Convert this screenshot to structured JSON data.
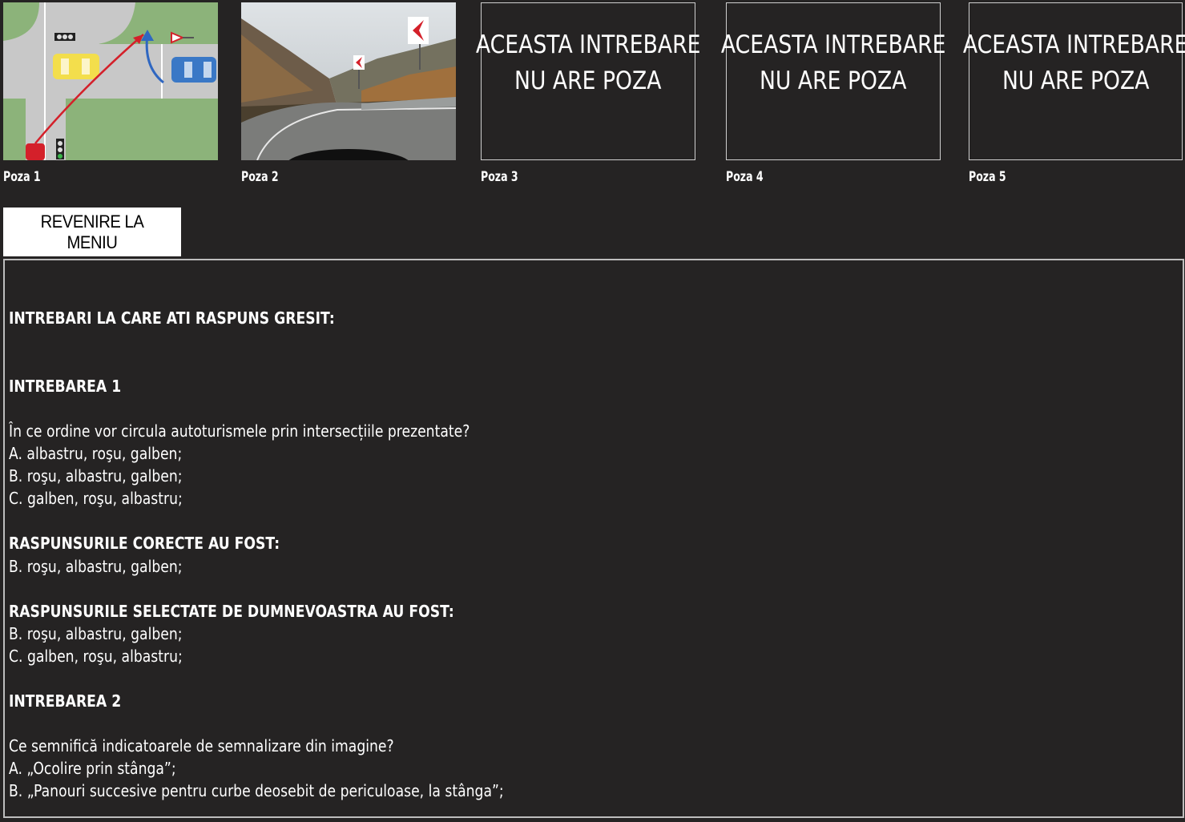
{
  "thumbnails": [
    {
      "caption": "Poza 1",
      "has_image": true
    },
    {
      "caption": "Poza 2",
      "has_image": true
    },
    {
      "caption": "Poza 3",
      "has_image": false
    },
    {
      "caption": "Poza 4",
      "has_image": false
    },
    {
      "caption": "Poza 5",
      "has_image": false
    }
  ],
  "no_image": {
    "line1": "ACEASTA INTREBARE",
    "line2": "NU ARE POZA"
  },
  "menu_button": "REVENIRE LA MENIU",
  "content": {
    "header": "INTREBARI LA CARE ATI RASPUNS GRESIT:",
    "questions": [
      {
        "title": "INTREBAREA 1",
        "text": "În ce ordine vor circula autoturismele prin intersecțiile prezentate?",
        "options": [
          "A. albastru, roşu, galben;",
          "B. roşu, albastru, galben;",
          "C. galben, roşu, albastru;"
        ],
        "correct_label": "RASPUNSURILE CORECTE AU FOST:",
        "correct": [
          "B. roşu, albastru, galben;"
        ],
        "selected_label": "RASPUNSURILE SELECTATE DE DUMNEVOASTRA AU FOST:",
        "selected": [
          "B. roşu, albastru, galben;",
          "C. galben, roşu, albastru;"
        ]
      },
      {
        "title": "INTREBAREA 2",
        "text": "Ce semnifică indicatoarele de semnalizare din imagine?",
        "options": [
          "A. „Ocolire prin stânga”;",
          "B. „Panouri succesive pentru curbe deosebit de periculoase, la stânga”;"
        ]
      }
    ]
  }
}
